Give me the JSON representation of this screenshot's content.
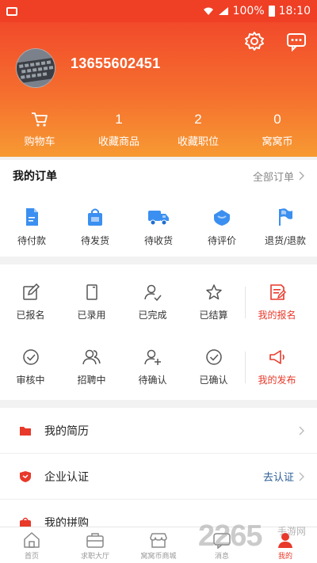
{
  "status_bar": {
    "battery": "100%",
    "time": "18:10"
  },
  "profile": {
    "phone": "13655602451"
  },
  "stats": [
    {
      "value": "",
      "label": "购物车"
    },
    {
      "value": "1",
      "label": "收藏商品"
    },
    {
      "value": "2",
      "label": "收藏职位"
    },
    {
      "value": "0",
      "label": "窝窝币"
    }
  ],
  "orders": {
    "title": "我的订单",
    "all_label": "全部订单",
    "items": [
      {
        "label": "待付款",
        "icon": "document-icon"
      },
      {
        "label": "待发货",
        "icon": "shopping-bag-icon"
      },
      {
        "label": "待收货",
        "icon": "delivery-truck-icon"
      },
      {
        "label": "待评价",
        "icon": "review-shield-icon"
      },
      {
        "label": "退货/退款",
        "icon": "flag-icon"
      }
    ]
  },
  "applications": {
    "row1": [
      {
        "label": "已报名",
        "icon": "edit-icon"
      },
      {
        "label": "已录用",
        "icon": "phone-device-icon"
      },
      {
        "label": "已完成",
        "icon": "user-check-icon"
      },
      {
        "label": "已结算",
        "icon": "star-icon"
      },
      {
        "label": "我的报名",
        "icon": "signup-doc-icon"
      }
    ],
    "row2": [
      {
        "label": "审核中",
        "icon": "check-circle-icon"
      },
      {
        "label": "招聘中",
        "icon": "users-icon"
      },
      {
        "label": "待确认",
        "icon": "user-add-icon"
      },
      {
        "label": "已确认",
        "icon": "check-circle-icon"
      },
      {
        "label": "我的发布",
        "icon": "megaphone-icon"
      }
    ]
  },
  "menu": {
    "resume": "我的简历",
    "company_cert": "企业认证",
    "company_cert_action": "去认证",
    "third": "我的拼购"
  },
  "tabs": [
    {
      "label": "首页",
      "icon": "home-icon"
    },
    {
      "label": "求职大厅",
      "icon": "briefcase-icon"
    },
    {
      "label": "窝窝币商城",
      "icon": "store-icon"
    },
    {
      "label": "消息",
      "icon": "message-icon"
    },
    {
      "label": "我的",
      "icon": "user-icon"
    }
  ],
  "watermark": {
    "logo": "2265",
    "site": "手游网"
  },
  "colors": {
    "accent": "#ef3f25",
    "order_icon": "#3b8ff0",
    "red_text": "#e8392a",
    "link": "#2a5d95"
  }
}
